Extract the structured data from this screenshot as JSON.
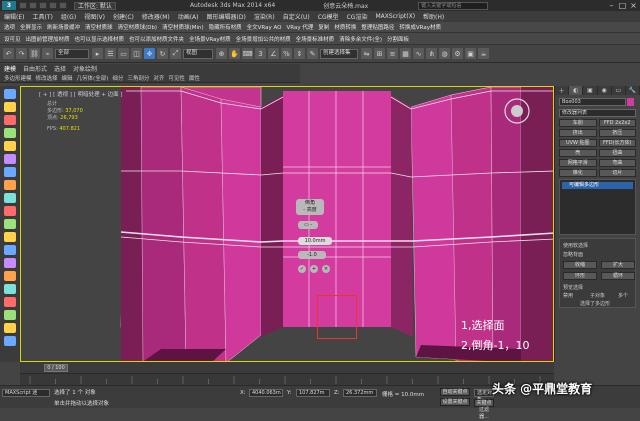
{
  "titlebar": {
    "workspace_label": "工作区: 默认",
    "app_title": "Autodesk 3ds Max  2014 x64",
    "file_name": "创意云朵椅.max",
    "search_placeholder": "键入关键字或短语"
  },
  "menu": [
    "编辑(E)",
    "工具(T)",
    "组(G)",
    "视图(V)",
    "创建(C)",
    "修改器(M)",
    "动画(A)",
    "图形编辑器(D)",
    "渲染(R)",
    "自定义(U)",
    "CG模型",
    "CG渲染",
    "MAXScript(X)",
    "帮助(H)"
  ],
  "ribbon_row1": [
    "选项",
    "全屏显示",
    "刷新场景缓冲",
    "清空材质球",
    "清空材质球(Db)",
    "清空材质球(Min)",
    "隐藏所有材质",
    "全文VRay AO",
    "VRay 代理",
    "复制",
    "材质转换",
    "整理贴图路径",
    "转换成VRay材质"
  ],
  "ribbon_row2": [
    "设可见",
    "出图前管理加材质",
    "也可以显示选择材质",
    "也可以添加材质文件夹",
    "全场景VRay材质",
    "全场景增加公共的材质",
    "全场景标准材质",
    "清除多余文件(全)",
    "分割面板"
  ],
  "toolbar": {
    "filter_all": "全部",
    "view_select": "视图",
    "selection_set": "创建选择集"
  },
  "graphite_tabs": [
    "建模",
    "自由形式",
    "选择",
    "对象绘制"
  ],
  "graphite_ribbon": [
    "多边形建模",
    "修改选择",
    "编辑",
    "几何体(全部)",
    "细分",
    "三角剖分",
    "对齐",
    "可见性",
    "属性"
  ],
  "viewport": {
    "label": "[ + ] [ 透视 ] [ 明暗处理 + 边面 ]",
    "stats": {
      "total_label": "总计",
      "polys_label": "多边形:",
      "polys_value": "37,070",
      "verts_label": "顶点:",
      "verts_value": "26,793",
      "fps_label": "FPS:",
      "fps_value": "407.821"
    },
    "caddy_title": "倒角",
    "caddy_sub": "- 高度",
    "caddy_value": "10.0mm",
    "caddy_height": "-1.0",
    "caddy_outline": "10"
  },
  "annotations": {
    "step1": "1,选择面",
    "step2": "2,倒角-1，10"
  },
  "command_panel": {
    "tabs": [
      "＋",
      "◐",
      "▣",
      "◉",
      "▭",
      "🔧"
    ],
    "object_name": "Box003",
    "modifier_list": "修改器列表",
    "buttons": [
      "车削",
      "FFD 2x2x2",
      "挤出",
      "挤压",
      "UVW 贴图",
      "FFD(长方体)",
      "壳",
      "扭曲",
      "网格平滑",
      "弯曲",
      "锥化",
      "切片"
    ],
    "stack_item": "可编辑多边形",
    "soft_selection": "使用软选择",
    "use_crease": "忽略背面",
    "shrink": "收缩",
    "expand": "扩大",
    "ring": "环形",
    "loop": "循环",
    "section_title": "预览选择",
    "disabled": "禁用",
    "sub_obj": "子对象",
    "multi": "多个",
    "selected": "选择了多边形"
  },
  "timeslider": {
    "label": "0 / 100"
  },
  "status": {
    "selected_text": "选择了 1 个 对象",
    "hint": "单击并拖动以选择对象",
    "x_label": "X:",
    "x_value": "4040.063m",
    "y_label": "Y:",
    "y_value": "107.827m",
    "z_label": "Z:",
    "z_value": "26.372mm",
    "grid": "栅格 = 10.0mm",
    "auto_key": "自动关键点",
    "selected_obj": "选定对象",
    "set_key": "设置关键点",
    "key_filter": "关键点过滤器...",
    "maxscript": "MAXScript 迷"
  },
  "watermark": "头条 @平鼎堂教育",
  "colors": {
    "model_face": "#d43b9e",
    "model_dark": "#7a1f55",
    "viewport_border": "#d9d900",
    "modifier_highlight": "#2b64a9"
  }
}
